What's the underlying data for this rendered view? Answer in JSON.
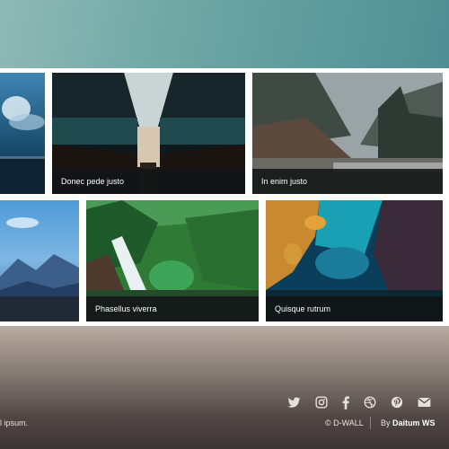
{
  "gallery": {
    "tiles": [
      {
        "id": "ocean-clouds",
        "caption": ""
      },
      {
        "id": "station",
        "caption": "Donec pede justo"
      },
      {
        "id": "forest-river",
        "caption": "In enim justo"
      },
      {
        "id": "mountain-sky",
        "caption": ""
      },
      {
        "id": "waterfall",
        "caption": "Phasellus viverra"
      },
      {
        "id": "aerial-coast",
        "caption": "Quisque rutrum"
      }
    ]
  },
  "footer": {
    "left_text": "l ipsum.",
    "copyright": "© D-WALL",
    "by_prefix": "By",
    "by_name": "Daitum WS",
    "social_icons": [
      "twitter-icon",
      "instagram-icon",
      "facebook-icon",
      "dribbble-icon",
      "pinterest-icon",
      "email-icon"
    ]
  }
}
